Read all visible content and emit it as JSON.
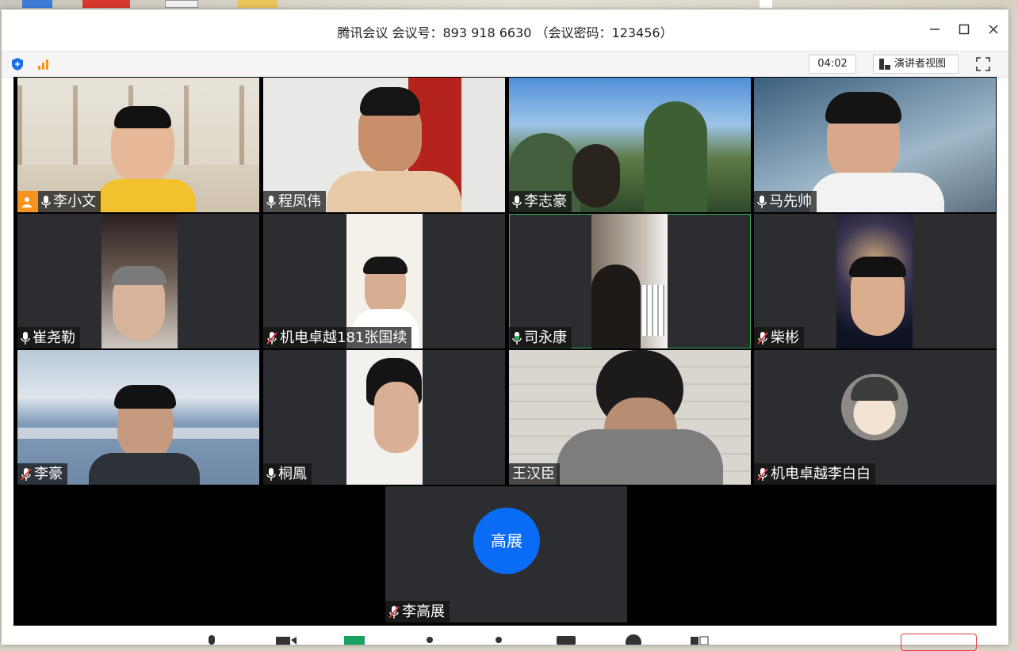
{
  "window": {
    "title": "腾讯会议 会议号：893 918 6630 （会议密码：123456）"
  },
  "toolbar": {
    "timer": "04:02",
    "speaker_view_label": "演讲者视图"
  },
  "participants": [
    {
      "name": "李小文",
      "mic": "on",
      "host": true
    },
    {
      "name": "程凤伟",
      "mic": "on"
    },
    {
      "name": "李志豪",
      "mic": "on"
    },
    {
      "name": "马先帅",
      "mic": "on"
    },
    {
      "name": "崔尧勒",
      "mic": "on"
    },
    {
      "name": "机电卓越181张国续",
      "mic": "muted"
    },
    {
      "name": "司永康",
      "mic": "speaking"
    },
    {
      "name": "柴彬",
      "mic": "muted"
    },
    {
      "name": "李豪",
      "mic": "muted"
    },
    {
      "name": "桐鳳",
      "mic": "on"
    },
    {
      "name": "王汉臣",
      "mic": "none"
    },
    {
      "name": "机电卓越李白白",
      "mic": "muted"
    },
    {
      "name": "李高展",
      "mic": "muted",
      "avatar_text": "高展"
    }
  ],
  "colors": {
    "avatar_blue": "#0a6cf5",
    "host_orange": "#f7931e",
    "mic_green": "#34b35a",
    "muted_red": "#e23c3c",
    "tile_bg": "#2b2d31"
  }
}
